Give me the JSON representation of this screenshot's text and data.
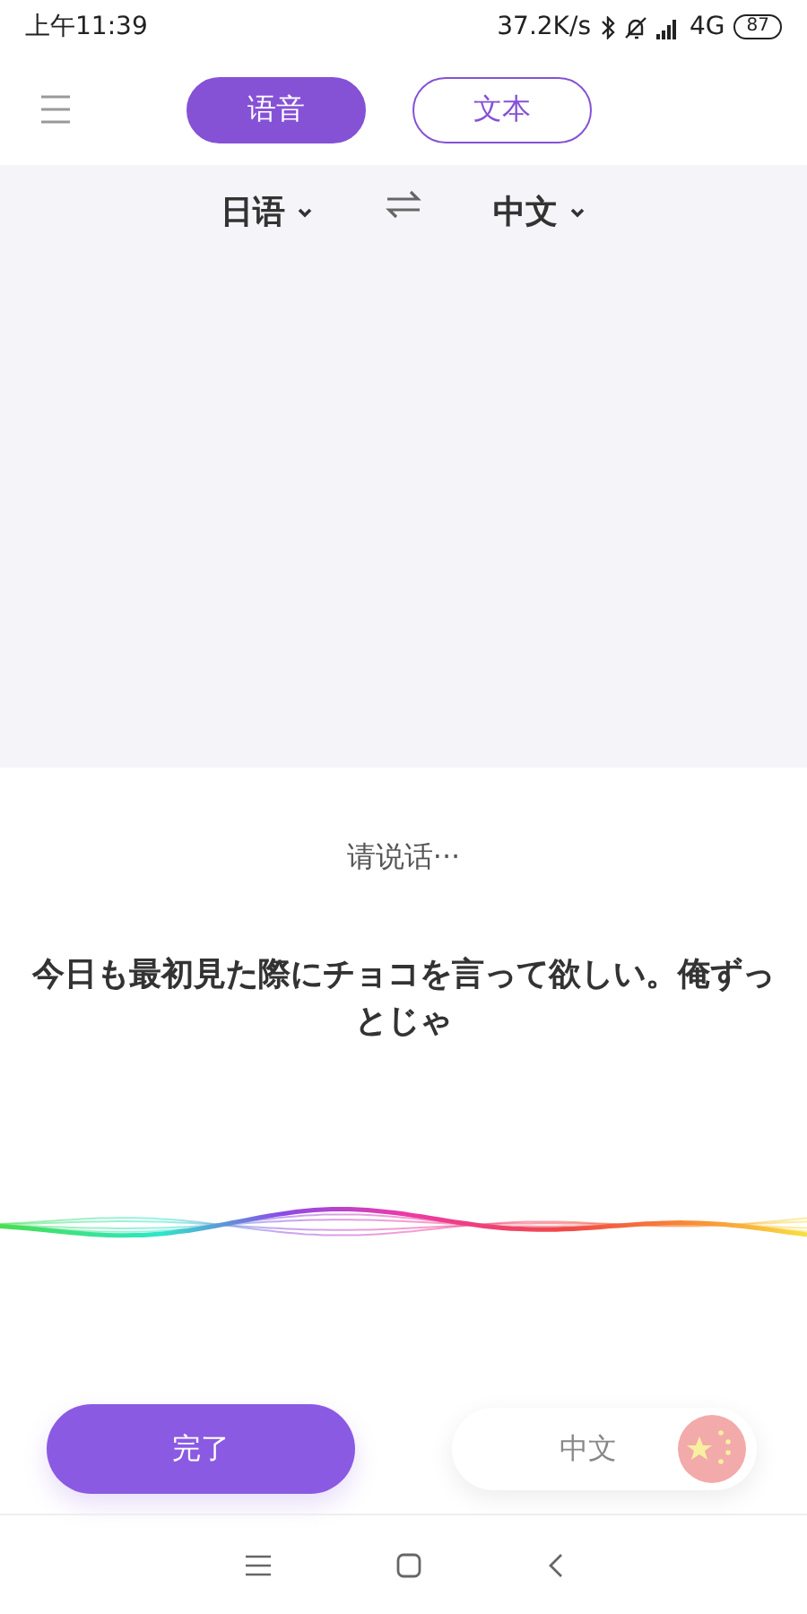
{
  "status_bar": {
    "time": "上午11:39",
    "speed": "37.2K/s",
    "network": "4G",
    "battery": "87"
  },
  "mode_tabs": [
    {
      "label": "语音",
      "selected": true
    },
    {
      "label": "文本",
      "selected": false
    }
  ],
  "languages": {
    "source": "日语",
    "target": "中文"
  },
  "prompt": "请说话···",
  "transcript": "今日も最初見た際にチョコを言って欲しい。俺ずっとじゃ",
  "done_button": "完了",
  "language_chip": "中文"
}
